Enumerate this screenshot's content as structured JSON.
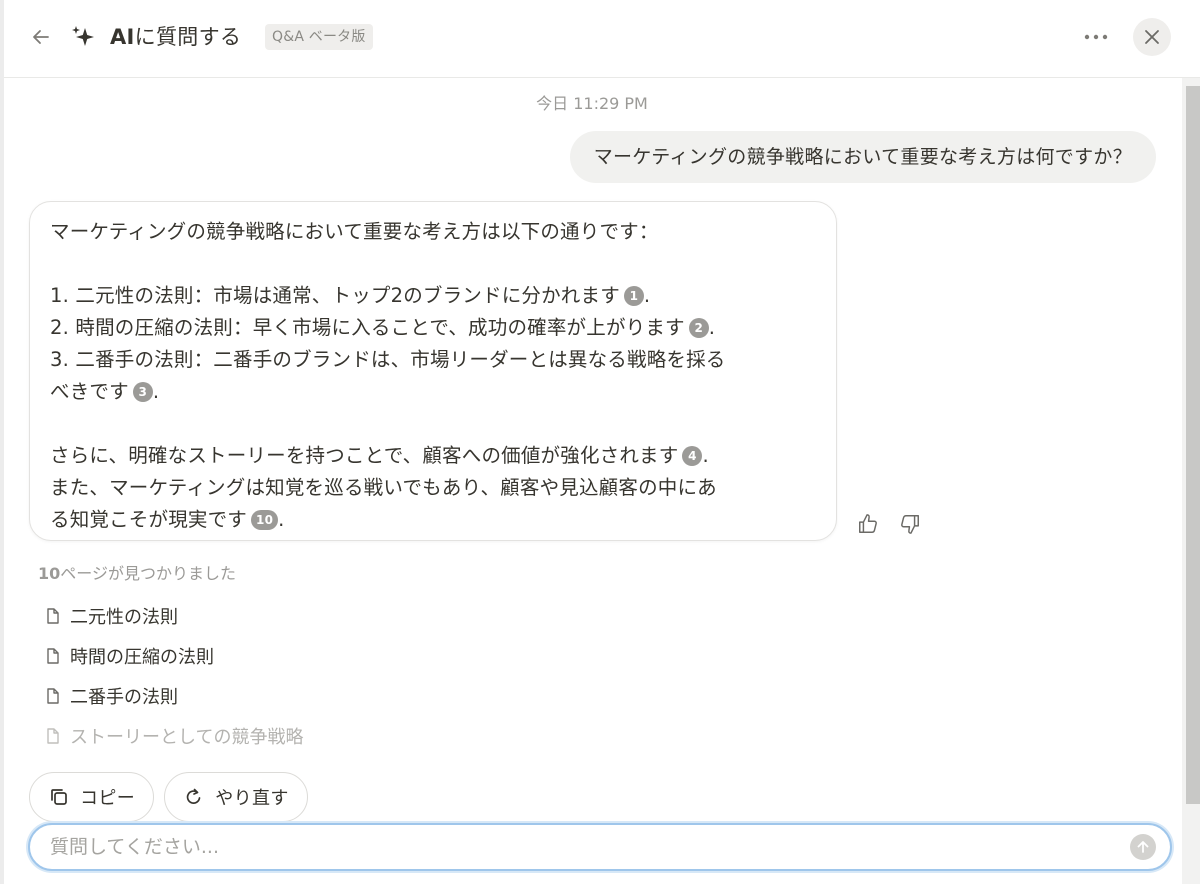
{
  "header": {
    "title_ai": "AI",
    "title_rest": "に質問する",
    "beta_badge": "Q&A ベータ版",
    "more_label": "•••"
  },
  "chat": {
    "timestamp": "今日 11:29 PM",
    "user_question": "マーケティングの競争戦略において重要な考え方は何ですか？",
    "answer": {
      "intro": "マーケティングの競争戦略において重要な考え方は以下の通りです：",
      "items": [
        {
          "text": "1. 二元性の法則：市場は通常、トップ2のブランドに分かれます",
          "cite": "1",
          "end": "."
        },
        {
          "text": "2. 時間の圧縮の法則：早く市場に入ることで、成功の確率が上がります",
          "cite": "2",
          "end": "."
        },
        {
          "text_line1": "3. 二番手の法則：二番手のブランドは、市場リーダーとは異なる戦略を採る",
          "text_line2": "べきです",
          "cite": "3",
          "end": "."
        }
      ],
      "para2_line1": "さらに、明確なストーリーを持つことで、顧客への価値が強化されます",
      "para2_cite1": "4",
      "para2_line2": "また、マーケティングは知覚を巡る戦いでもあり、顧客や見込顧客の中にあ",
      "para2_line3": "る知覚こそが現実です",
      "para2_cite2": "10",
      "period": "."
    }
  },
  "sources": {
    "count": "10",
    "count_suffix": "ページが見つかりました",
    "items": [
      {
        "label": "二元性の法則"
      },
      {
        "label": "時間の圧縮の法則"
      },
      {
        "label": "二番手の法則"
      },
      {
        "label": "ストーリーとしての競争戦略"
      }
    ]
  },
  "actions": {
    "copy_label": "コピー",
    "retry_label": "やり直す"
  },
  "input": {
    "placeholder": "質問してください..."
  },
  "colors": {
    "accent_focus": "#9fc6eb",
    "citation_badge": "#9b9a97"
  }
}
